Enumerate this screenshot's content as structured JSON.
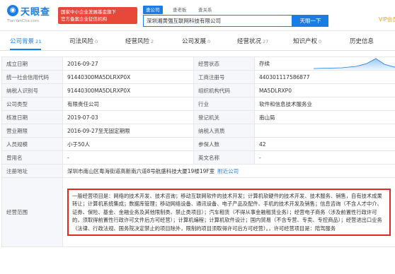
{
  "header": {
    "logo_text": "天眼查",
    "logo_sub": "TianYanCha.com",
    "gov_badge": [
      "国家中小企业发展基金旗下",
      "官方备案企业征信机构"
    ],
    "search_tabs": [
      "查公司",
      "查老板",
      "查关系"
    ],
    "search_value": "深圳湘黄强互联网科技有限公司",
    "search_button": "天眼一下",
    "vip_label": "VIP会员"
  },
  "tabs": [
    {
      "label": "公司背景",
      "count": "21"
    },
    {
      "label": "司法风险",
      "count": "0"
    },
    {
      "label": "经营风险",
      "count": "2"
    },
    {
      "label": "公司发展",
      "count": "0"
    },
    {
      "label": "经营状况",
      "count": "27"
    },
    {
      "label": "知识产权",
      "count": "0"
    },
    {
      "label": "历史信息",
      "count": ""
    }
  ],
  "rows": [
    {
      "l1": "成立日期",
      "v1": "2016-09-27",
      "l2": "经营状态",
      "v2": "存续"
    },
    {
      "l1": "统一社会信用代码",
      "v1": "91440300MA5DLRXP0X",
      "l2": "工商注册号",
      "v2": "440301117586877"
    },
    {
      "l1": "纳税人识别号",
      "v1": "91440300MA5DLRXP0X",
      "l2": "组织机构代码",
      "v2": "MA5DLRXP0"
    },
    {
      "l1": "公司类型",
      "v1": "有限责任公司",
      "l2": "行业",
      "v2": "软件和信息技术服务业"
    },
    {
      "l1": "核准日期",
      "v1": "2019-07-03",
      "l2": "登记机关",
      "v2": "南山局"
    },
    {
      "l1": "营业期限",
      "v1": "2016-09-27至无固定期限",
      "l2": "纳税人资质",
      "v2": ""
    },
    {
      "l1": "人员规模",
      "v1": "小于50人",
      "l2": "参保人数",
      "v2": "42"
    },
    {
      "l1": "曾用名",
      "v1": "-",
      "l2": "英文名称",
      "v2": "-"
    }
  ],
  "address": {
    "label": "注册地址",
    "value": "深圳市南山区粤海街道高新南六道8号航盛科技大厦19楼19F室",
    "link": "附近公司"
  },
  "scope": {
    "label": "经营范围",
    "text": "一般经营项目是：网络的技术开发、技术咨询；移动互联网软件的技术开发；计算机软硬件的技术开发、技术服务、销售，自有技术成果转让；计算机系统集成；数据库管理；移动网络设备、通讯设备、电子产品及配件、手机的技术开发及销售；信息咨询（不含人才中介、证券、保险、基金、金融业务及其他限制类、禁止类项目）；汽车租赁（不得从事金融租赁业务）；经营电子商务（涉及前置性行政许可的，须取得前置性行政许可文件后方可经营）；计算机编程；计算机软件设计；国内贸易（不含专营、专卖、专控商品）；经营进出口业务（法律、行政法规、国务院决定禁止的项目除外，限制的项目须取得许可后方可经营）。，许可经营项目是：陪驾服务"
  },
  "colors": {
    "brand": "#1a7de6",
    "highlight": "#e0281e",
    "vip": "#f0a020"
  }
}
